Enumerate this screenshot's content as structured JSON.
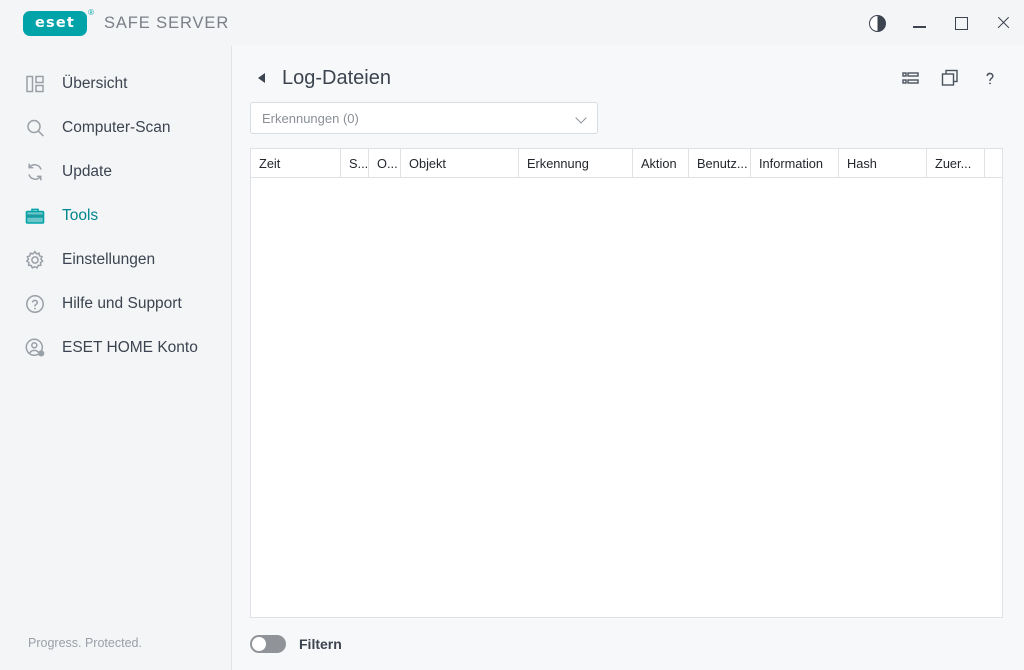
{
  "window": {
    "brand_logo_text": "eset",
    "brand_registered": "®",
    "product_name": "SAFE SERVER",
    "controls": {
      "contrast": "contrast-toggle",
      "minimize": "minimize",
      "maximize": "maximize",
      "close": "close"
    }
  },
  "sidebar": {
    "items": [
      {
        "label": "Übersicht",
        "icon": "dashboard-icon",
        "active": false
      },
      {
        "label": "Computer-Scan",
        "icon": "search-icon",
        "active": false
      },
      {
        "label": "Update",
        "icon": "refresh-icon",
        "active": false
      },
      {
        "label": "Tools",
        "icon": "toolbox-icon",
        "active": true
      },
      {
        "label": "Einstellungen",
        "icon": "gear-icon",
        "active": false
      },
      {
        "label": "Hilfe und Support",
        "icon": "help-icon",
        "active": false
      },
      {
        "label": "ESET HOME Konto",
        "icon": "account-icon",
        "active": false
      }
    ],
    "tagline": "Progress. Protected."
  },
  "page": {
    "title": "Log-Dateien",
    "back": "back-arrow",
    "actions": [
      {
        "name": "list-view-icon"
      },
      {
        "name": "copy-window-icon"
      },
      {
        "name": "help-icon"
      }
    ]
  },
  "filter_select": {
    "value": "Erkennungen (0)",
    "chevron": "chevron-down-icon"
  },
  "table": {
    "columns": [
      {
        "label": "Zeit",
        "width": 90
      },
      {
        "label": "S...",
        "width": 28
      },
      {
        "label": "O...",
        "width": 32
      },
      {
        "label": "Objekt",
        "width": 118
      },
      {
        "label": "Erkennung",
        "width": 114
      },
      {
        "label": "Aktion",
        "width": 56
      },
      {
        "label": "Benutz...",
        "width": 62
      },
      {
        "label": "Information",
        "width": 88
      },
      {
        "label": "Hash",
        "width": 88
      },
      {
        "label": "Zuer...",
        "width": 58
      },
      {
        "label": "",
        "width": 28
      }
    ],
    "rows": []
  },
  "footer": {
    "filter_toggle_label": "Filtern",
    "filter_toggle_on": false
  },
  "colors": {
    "accent": "#00a3a8",
    "accent_text": "#00868c",
    "sidebar_bg": "#f4f5f7",
    "main_bg": "#f7f8f9",
    "text": "#3c4450",
    "muted": "#8b9097"
  }
}
